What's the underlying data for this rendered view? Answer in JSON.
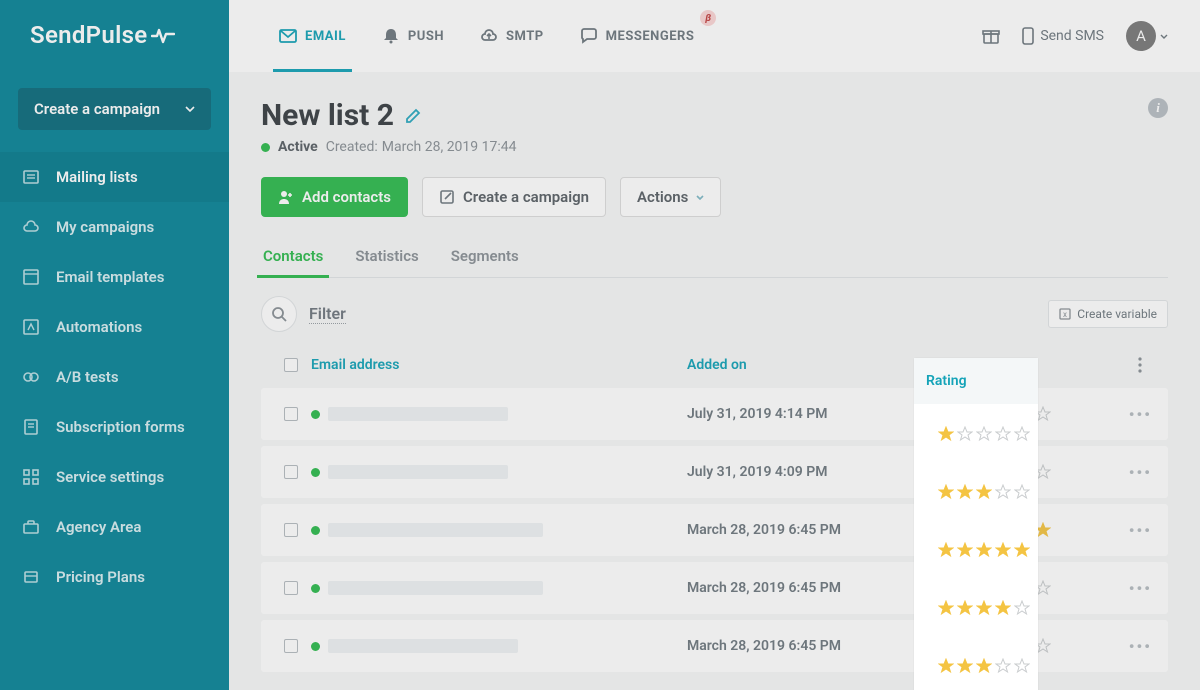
{
  "brand": "SendPulse",
  "create_campaign": "Create a campaign",
  "sidebar": {
    "items": [
      {
        "label": "Mailing lists",
        "icon": "list-icon",
        "active": true
      },
      {
        "label": "My campaigns",
        "icon": "cloud-icon"
      },
      {
        "label": "Email templates",
        "icon": "template-icon"
      },
      {
        "label": "Automations",
        "icon": "automation-icon"
      },
      {
        "label": "A/B tests",
        "icon": "ab-icon"
      },
      {
        "label": "Subscription forms",
        "icon": "form-icon"
      },
      {
        "label": "Service settings",
        "icon": "grid-icon"
      },
      {
        "label": "Agency Area",
        "icon": "briefcase-icon"
      },
      {
        "label": "Pricing Plans",
        "icon": "pricing-icon"
      }
    ]
  },
  "topnav": {
    "channels": [
      {
        "label": "EMAIL",
        "icon": "mail-icon",
        "active": true
      },
      {
        "label": "PUSH",
        "icon": "bell-icon"
      },
      {
        "label": "SMTP",
        "icon": "cloud-up-icon"
      },
      {
        "label": "MESSENGERS",
        "icon": "chat-icon",
        "beta": "β"
      }
    ],
    "send_sms": "Send SMS",
    "avatar_letter": "A"
  },
  "page": {
    "title": "New list 2",
    "status": "Active",
    "created_prefix": "Created:",
    "created": "March 28, 2019 17:44",
    "buttons": {
      "add_contacts": "Add contacts",
      "create_campaign": "Create a campaign",
      "actions": "Actions"
    },
    "tabs": [
      {
        "label": "Contacts",
        "active": true
      },
      {
        "label": "Statistics"
      },
      {
        "label": "Segments"
      }
    ],
    "filter_label": "Filter",
    "create_variable": "Create variable",
    "columns": {
      "email": "Email address",
      "added": "Added on",
      "rating": "Rating"
    },
    "rows": [
      {
        "added": "July 31, 2019 4:14 PM",
        "rating": 1,
        "blur": 180
      },
      {
        "added": "July 31, 2019 4:09 PM",
        "rating": 3,
        "blur": 180
      },
      {
        "added": "March 28, 2019 6:45 PM",
        "rating": 5,
        "blur": 215
      },
      {
        "added": "March 28, 2019 6:45 PM",
        "rating": 4,
        "blur": 215
      },
      {
        "added": "March 28, 2019 6:45 PM",
        "rating": 3,
        "blur": 190
      }
    ]
  }
}
